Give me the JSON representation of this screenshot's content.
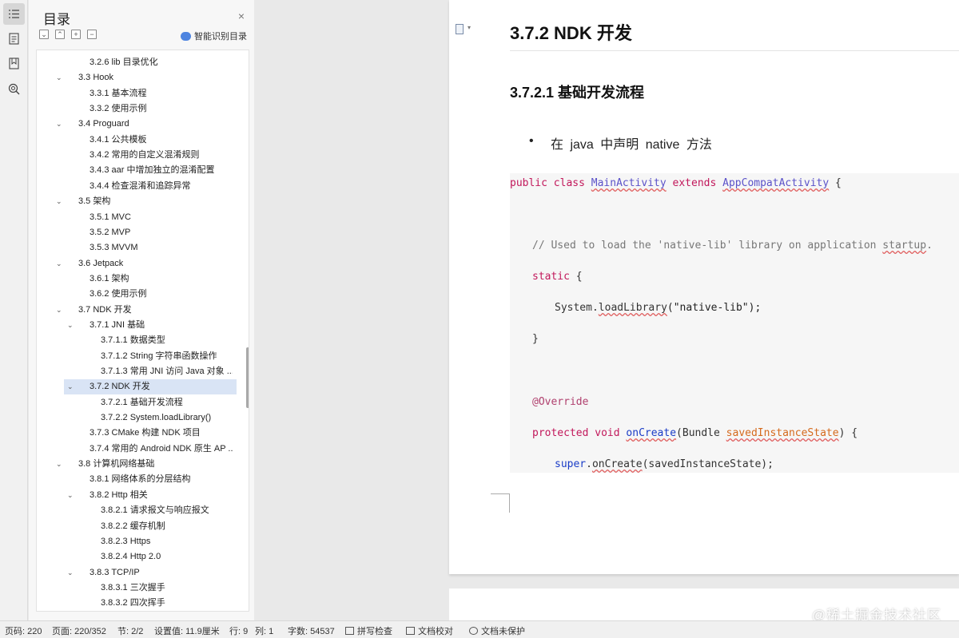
{
  "sidebar": {
    "icons": [
      "toc-icon",
      "document-icon",
      "bookmark-icon",
      "find-icon"
    ]
  },
  "toc": {
    "title": "目录",
    "close": "×",
    "tools": [
      "expand-all",
      "collapse-all",
      "add",
      "remove"
    ],
    "smart_label": "智能识别目录",
    "items": [
      {
        "label": "3.2.6 lib 目录优化",
        "level": 2,
        "chev": false
      },
      {
        "label": "3.3 Hook",
        "level": 1,
        "chev": true
      },
      {
        "label": "3.3.1  基本流程",
        "level": 2,
        "chev": false
      },
      {
        "label": "3.3.2  使用示例",
        "level": 2,
        "chev": false
      },
      {
        "label": "3.4 Proguard",
        "level": 1,
        "chev": true
      },
      {
        "label": "3.4.1  公共模板",
        "level": 2,
        "chev": false
      },
      {
        "label": "3.4.2  常用的自定义混淆规则",
        "level": 2,
        "chev": false
      },
      {
        "label": "3.4.3 aar 中增加独立的混淆配置",
        "level": 2,
        "chev": false
      },
      {
        "label": "3.4.4  检查混淆和追踪异常",
        "level": 2,
        "chev": false
      },
      {
        "label": "3.5  架构",
        "level": 1,
        "chev": true
      },
      {
        "label": "3.5.1 MVC",
        "level": 2,
        "chev": false
      },
      {
        "label": "3.5.2 MVP",
        "level": 2,
        "chev": false
      },
      {
        "label": "3.5.3 MVVM",
        "level": 2,
        "chev": false
      },
      {
        "label": "3.6 Jetpack",
        "level": 1,
        "chev": true
      },
      {
        "label": "3.6.1  架构",
        "level": 2,
        "chev": false
      },
      {
        "label": "3.6.2  使用示例",
        "level": 2,
        "chev": false
      },
      {
        "label": "3.7 NDK  开发",
        "level": 1,
        "chev": true
      },
      {
        "label": "3.7.1 JNI  基础",
        "level": 2,
        "chev": true
      },
      {
        "label": "3.7.1.1  数据类型",
        "level": 3,
        "chev": false
      },
      {
        "label": "3.7.1.2 String  字符串函数操作",
        "level": 3,
        "chev": false
      },
      {
        "label": "3.7.1.3  常用  JNI  访问  Java  对象 ...",
        "level": 3,
        "chev": false
      },
      {
        "label": "3.7.2 NDK  开发",
        "level": 2,
        "chev": true,
        "selected": true
      },
      {
        "label": "3.7.2.1  基础开发流程",
        "level": 3,
        "chev": false
      },
      {
        "label": "3.7.2.2 System.loadLibrary()",
        "level": 3,
        "chev": false
      },
      {
        "label": "3.7.3 CMake  构建  NDK  项目",
        "level": 2,
        "chev": false
      },
      {
        "label": "3.7.4  常用的  Android NDK  原生  AP ...",
        "level": 2,
        "chev": false
      },
      {
        "label": "3.8  计算机网络基础",
        "level": 1,
        "chev": true
      },
      {
        "label": "3.8.1  网络体系的分层结构",
        "level": 2,
        "chev": false
      },
      {
        "label": "3.8.2 Http  相关",
        "level": 2,
        "chev": true
      },
      {
        "label": "3.8.2.1  请求报文与响应报文",
        "level": 3,
        "chev": false
      },
      {
        "label": "3.8.2.2  缓存机制",
        "level": 3,
        "chev": false
      },
      {
        "label": "3.8.2.3 Https",
        "level": 3,
        "chev": false
      },
      {
        "label": "3.8.2.4 Http 2.0",
        "level": 3,
        "chev": false
      },
      {
        "label": "3.8.3 TCP/IP",
        "level": 2,
        "chev": true
      },
      {
        "label": "3.8.3.1  三次握手",
        "level": 3,
        "chev": false
      },
      {
        "label": "3.8.3.2  四次挥手",
        "level": 3,
        "chev": false
      }
    ]
  },
  "doc": {
    "heading1": "3.7.2 NDK  开发",
    "heading2": "3.7.2.1  基础开发流程",
    "bullet": "在  java  中声明  native  方法",
    "code": {
      "l1_public": "public",
      "l1_class": "class",
      "l1_name": "MainActivity",
      "l1_extends": "extends",
      "l1_parent": "AppCompatActivity",
      "l1_brace": " {",
      "l2_comment": "// Used to load the 'native-lib' library on application ",
      "l2_startup": "startup",
      "l2_dot": ".",
      "l3_static": "static",
      "l3_brace": " {",
      "l4_system": "System.",
      "l4_method": "loadLibrary",
      "l4_args": "(\"native-lib\");",
      "l5_close": "}",
      "l6_override": "@Override",
      "l7_protected": "protected",
      "l7_void": "void",
      "l7_method": "onCreate",
      "l7_paren": "(Bundle ",
      "l7_param": "savedInstanceState",
      "l7_end": ") {",
      "l8_super": "super",
      "l8_dot": ".",
      "l8_method": "onCreate",
      "l8_args": "(savedInstanceState);"
    }
  },
  "status": {
    "page_code": "页码: 220",
    "page": "页面: 220/352",
    "section": "节: 2/2",
    "setting": "设置值: 11.9厘米",
    "row": "行: 9",
    "col": "列: 1",
    "words": "字数: 54537",
    "spell": "拼写检查",
    "proof": "文档校对",
    "protect": "文档未保护"
  },
  "watermark": "@稀土掘金技术社区"
}
